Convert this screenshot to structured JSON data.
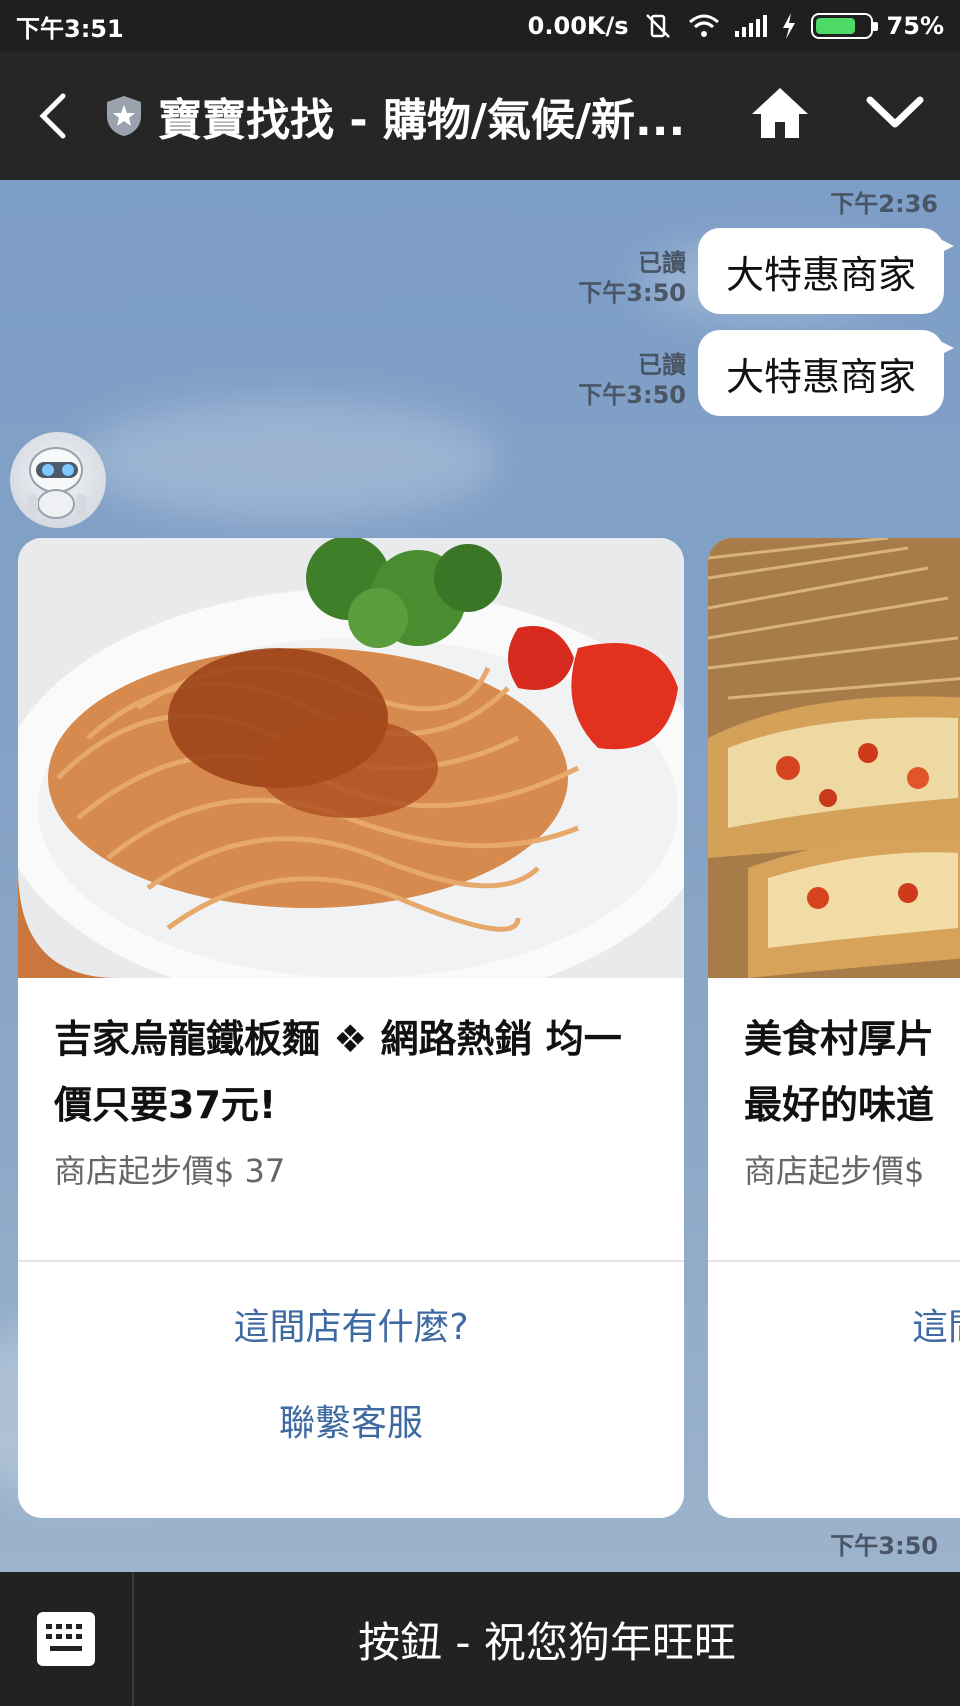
{
  "status": {
    "time": "下午3:51",
    "net_speed": "0.00K/s",
    "battery": "75%",
    "battery_level": 0.75
  },
  "header": {
    "title": "寶寶找找 - 購物/氣候/新...",
    "icons": [
      "back-arrow-icon",
      "shield-icon",
      "home-icon",
      "chevron-down-icon"
    ]
  },
  "chat": {
    "top_time": "下午2:36",
    "messages": [
      {
        "read": "已讀",
        "time": "下午3:50",
        "text": "大特惠商家"
      },
      {
        "read": "已讀",
        "time": "下午3:50",
        "text": "大特惠商家"
      }
    ],
    "cards": [
      {
        "title": "吉家烏龍鐵板麵 ❖ 網路熱銷 均一價只要37元!",
        "price": "商店起步價$ 37",
        "actions": [
          "這間店有什麼?",
          "聯繫客服"
        ]
      },
      {
        "title": "美食村厚片 最好的味道",
        "price": "商店起步價$",
        "actions": [
          "這間店有什麼?"
        ]
      }
    ],
    "bottom_time": "下午3:50"
  },
  "bottom_bar": {
    "menu_label": "按鈕 - 祝您狗年旺旺"
  },
  "colors": {
    "chat_bg": "#7f9dc1",
    "link": "#3e6aa1",
    "bar": "#262626"
  }
}
